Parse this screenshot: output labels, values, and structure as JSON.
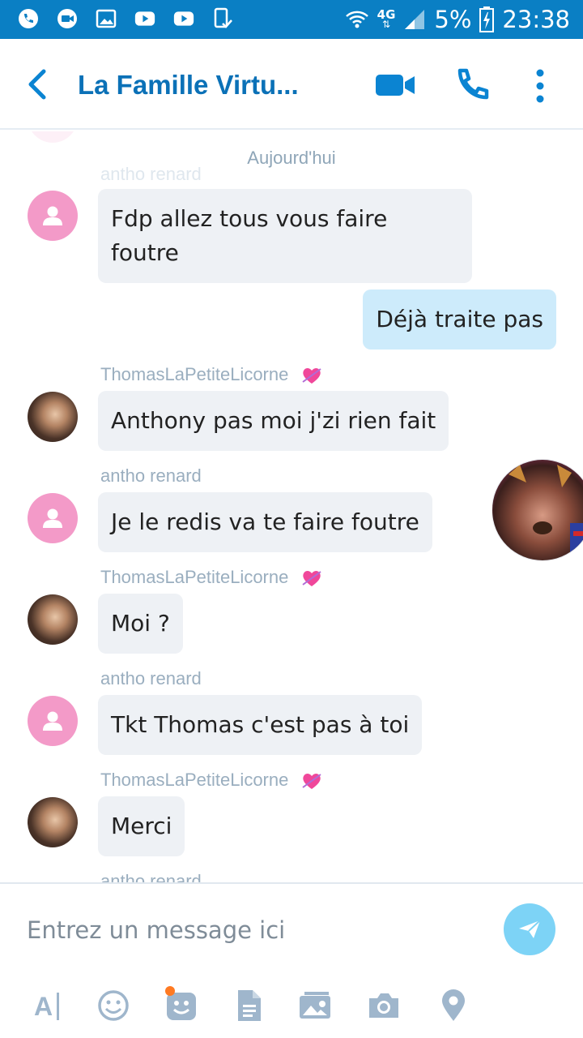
{
  "status_bar": {
    "battery": "5%",
    "time": "23:38",
    "network": "4G",
    "icons": [
      "phone-icon",
      "video-icon",
      "image-icon",
      "youtube-icon",
      "youtube-icon",
      "phone-check-icon",
      "wifi-icon",
      "signal-icon",
      "battery-icon"
    ]
  },
  "header": {
    "title": "La Famille Virtu...",
    "back_icon": "chevron-left-icon",
    "video_icon": "video-call-icon",
    "call_icon": "phone-call-icon",
    "more_icon": "more-vertical-icon",
    "accent_color": "#0b71b7"
  },
  "chat": {
    "date_label": "Aujourd'hui",
    "faded_top_sender": "antho renard",
    "messages": [
      {
        "sender": "",
        "text_line1": "Fdp allez tous vous faire",
        "text_line2": "foutre",
        "direction": "in",
        "avatar": "default"
      },
      {
        "sender": "",
        "text": "Déjà traite pas",
        "direction": "out"
      },
      {
        "sender": "ThomasLaPetiteLicorne",
        "text": "Anthony pas moi j'zi rien fait",
        "direction": "in",
        "avatar": "photo"
      },
      {
        "sender": "antho renard",
        "text": "Je le redis va te faire foutre",
        "direction": "in",
        "avatar": "default"
      },
      {
        "sender": "ThomasLaPetiteLicorne",
        "text": "Moi ?",
        "direction": "in",
        "avatar": "photo"
      },
      {
        "sender": "antho renard",
        "text": "Tkt Thomas c'est pas à toi",
        "direction": "in",
        "avatar": "default"
      },
      {
        "sender": "ThomasLaPetiteLicorne",
        "text": "Merci",
        "direction": "in",
        "avatar": "photo"
      }
    ],
    "cut_sender": "antho renard"
  },
  "composer": {
    "placeholder": "Entrez un message ici",
    "send_icon": "send-icon",
    "tools": [
      "text-format-icon",
      "emoji-icon",
      "sticker-icon",
      "file-icon",
      "media-icon",
      "camera-icon",
      "location-icon"
    ]
  },
  "colors": {
    "status_bar": "#0a7fc4",
    "incoming_bubble": "#eef1f5",
    "outgoing_bubble": "#cdebfb",
    "default_avatar": "#f39ac8",
    "send_button": "#7dd3f6"
  }
}
